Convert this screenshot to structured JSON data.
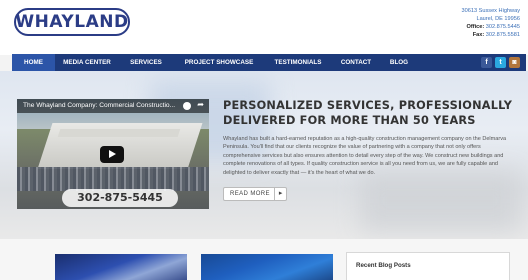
{
  "header": {
    "logo_text": "WHAYLAND",
    "address_line1": "30613 Sussex Highway",
    "address_line2": "Laurel, DE 19956",
    "office_label": "Office:",
    "office_phone": "302.875.5445",
    "fax_label": "Fax:",
    "fax_phone": "302.875.5581"
  },
  "nav": {
    "items": [
      "HOME",
      "MEDIA CENTER",
      "SERVICES",
      "PROJECT SHOWCASE",
      "TESTIMONIALS",
      "CONTACT",
      "BLOG"
    ],
    "active": "HOME",
    "social": [
      {
        "icon": "facebook-icon",
        "glyph": "f",
        "color": "#3b5998"
      },
      {
        "icon": "twitter-icon",
        "glyph": "t",
        "color": "#2ba8e0"
      },
      {
        "icon": "instagram-icon",
        "glyph": "◙",
        "color": "#b2763c"
      }
    ]
  },
  "hero": {
    "video_title": "The Whayland Company: Commercial Constructio...",
    "video_phone": "302-875-5445",
    "headline": "PERSONALIZED SERVICES, PROFESSIONALLY DELIVERED FOR MORE THAN 50 YEARS",
    "body": "Whayland has built a hard-earned reputation as a high-quality construction management company on the Delmarva Peninsula. You'll find that our clients recognize the value of partnering with a company that not only offers comprehensive services but also ensures attention to detail every step of the way. We construct new buildings and complete renovations of all types. If quality construction service is all you need from us, we are fully capable and delighted to deliver exactly that — it's the heart of what we do.",
    "read_more": "READ MORE",
    "read_more_arrow": "▸"
  },
  "sidebar": {
    "recent_posts_title": "Recent Blog Posts"
  },
  "colors": {
    "brand": "#2b3c86",
    "nav_bg": "#1d3a7a",
    "nav_active": "#2c55a8",
    "link": "#3a6fb7"
  }
}
